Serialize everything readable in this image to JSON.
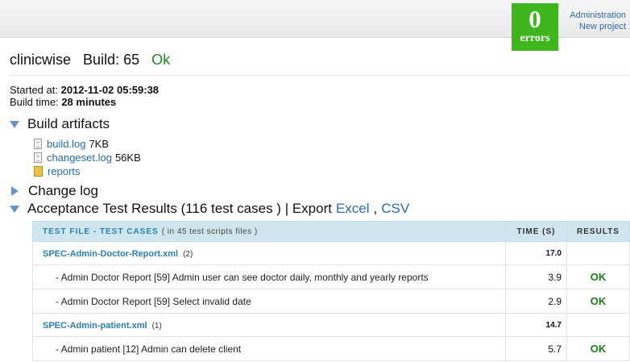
{
  "topbar": {
    "errors_count": "0",
    "errors_label": "errors",
    "links": [
      "Administration",
      "New project"
    ]
  },
  "header": {
    "project": "clinicwise",
    "build": "Build: 65",
    "status": "Ok"
  },
  "meta": {
    "started_label": "Started at:",
    "started_value": "2012-11-02 05:59:38",
    "buildtime_label": "Build time:",
    "buildtime_value": "28 minutes"
  },
  "sections": {
    "artifacts": "Build artifacts",
    "changelog": "Change log",
    "acceptance_prefix": "Acceptance Test Results (116 test cases ) | Export",
    "excel": "Excel",
    "separator": ",",
    "csv": "CSV"
  },
  "artifacts": [
    {
      "name": "build.log",
      "size": "7KB",
      "icon": "file-icon"
    },
    {
      "name": "changeset.log",
      "size": "56KB",
      "icon": "file-icon"
    },
    {
      "name": "reports",
      "size": "",
      "icon": "folder-icon"
    }
  ],
  "table": {
    "col_file": "Test File - Test Cases",
    "col_file_sub": "( in 45 test scripts files )",
    "col_time": "Time (s)",
    "col_results": "Results",
    "rows": [
      {
        "type": "file",
        "name": "SPEC-Admin-Doctor-Report.xml",
        "count": "(2)",
        "time": "17.0",
        "result": ""
      },
      {
        "type": "case",
        "name": "- Admin Doctor Report [59] Admin user can see doctor daily, monthly and yearly reports",
        "time": "3.9",
        "result": "OK"
      },
      {
        "type": "case",
        "name": "- Admin Doctor Report [59] Select invalid date",
        "time": "2.9",
        "result": "OK"
      },
      {
        "type": "file",
        "name": "SPEC-Admin-patient.xml",
        "count": "(1)",
        "time": "14.7",
        "result": ""
      },
      {
        "type": "case",
        "name": "- Admin patient [12] Admin can delete client",
        "time": "5.7",
        "result": "OK"
      }
    ]
  },
  "colors": {
    "ok": "#1f8a1f",
    "badge": "#3fb51e",
    "link": "#2a6bb5",
    "table_header": "#cfe6ee"
  }
}
